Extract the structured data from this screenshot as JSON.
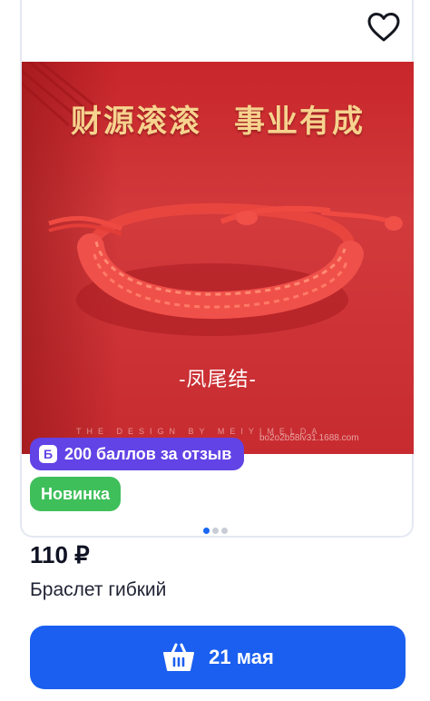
{
  "product": {
    "image": {
      "banner": "财源滚滚　事业有成",
      "knot_label": "-凤尾结-",
      "design_line": "THE DESIGN BY MEIYIMELDA",
      "watermark_url": "bo2o2b58lv31.1688.com"
    },
    "badges": {
      "points": "200 баллов за отзыв",
      "points_icon": "Б",
      "new": "Новинка"
    },
    "gallery": {
      "total": 3,
      "active": 1
    },
    "price": "110 ₽",
    "title": "Браслет гибкий",
    "delivery_button": "21 мая"
  },
  "icons": {
    "favorite": "heart-icon",
    "cart": "basket-icon"
  },
  "colors": {
    "accent_blue": "#1a5ff0",
    "points_badge": "#6243e6",
    "new_badge": "#3fbf5a",
    "photo_red": "#c8262b"
  }
}
